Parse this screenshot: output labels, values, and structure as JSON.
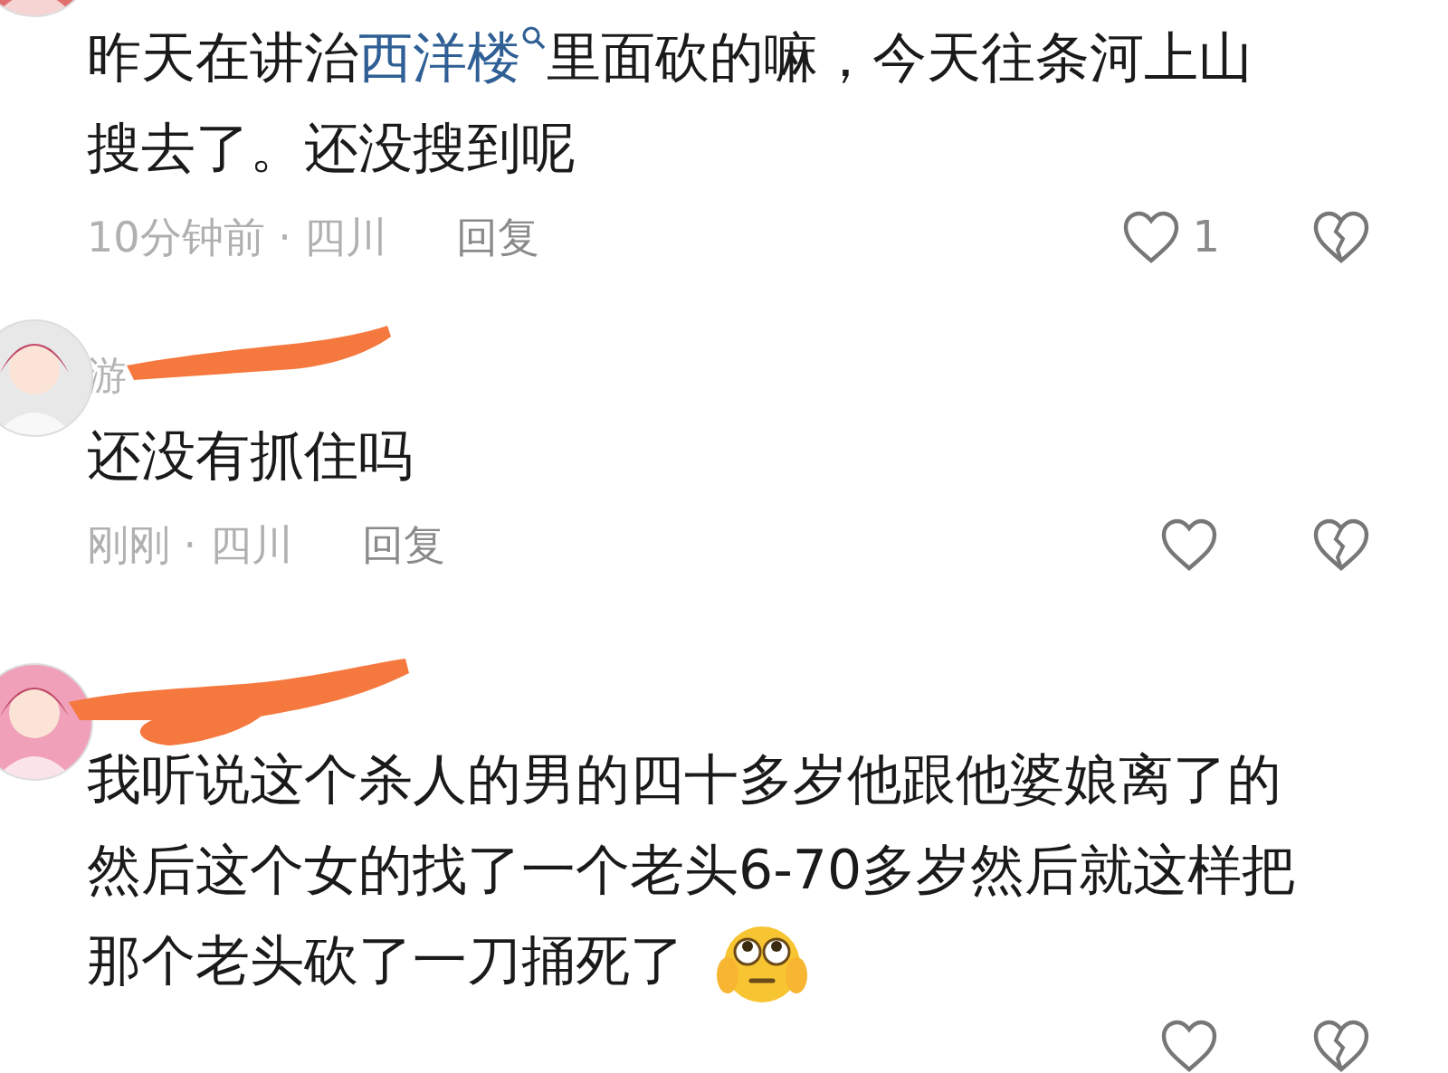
{
  "comments": [
    {
      "avatar": {
        "kind": "picture"
      },
      "lines": [
        [
          {
            "kind": "text",
            "value": "昨天在讲治"
          },
          {
            "kind": "link",
            "value": "西洋楼"
          },
          {
            "kind": "text",
            "value": "里面砍的嘛，今天往条河上山"
          }
        ],
        [
          {
            "kind": "text",
            "value": "搜去了。还没搜到呢"
          }
        ]
      ],
      "meta": "10分钟前 · 四川",
      "reply": "回复",
      "likes": "1"
    },
    {
      "avatar": {
        "kind": "picture"
      },
      "username": "游",
      "redacted": true,
      "lines": [
        [
          {
            "kind": "text",
            "value": "还没有抓住吗"
          }
        ]
      ],
      "meta": "刚刚 · 四川",
      "reply": "回复"
    },
    {
      "avatar": {
        "kind": "picture"
      },
      "redacted": true,
      "lines": [
        [
          {
            "kind": "text",
            "value": "我听说这个杀人的男的四十多岁他跟他婆娘离了的"
          }
        ],
        [
          {
            "kind": "text",
            "value": "然后这个女的找了一个老头6-70多岁然后就这样把"
          }
        ],
        [
          {
            "kind": "text",
            "value": "那个老头砍了一刀捅死了"
          },
          {
            "kind": "emoji"
          }
        ]
      ]
    }
  ]
}
